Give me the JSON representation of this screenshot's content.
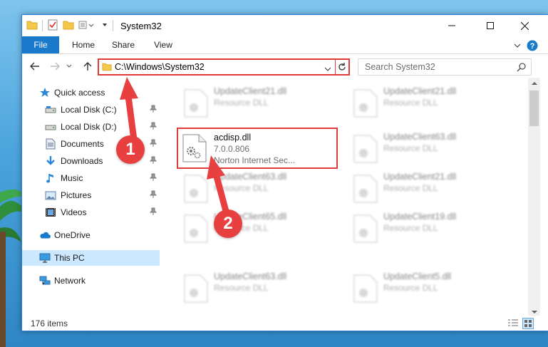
{
  "window": {
    "title": "System32",
    "buttons": {
      "minimize_icon": "minimize-icon",
      "maximize_icon": "maximize-icon",
      "close_icon": "close-icon"
    }
  },
  "ribbon": {
    "tabs": [
      {
        "label": "File",
        "active": true
      },
      {
        "label": "Home"
      },
      {
        "label": "Share"
      },
      {
        "label": "View"
      }
    ]
  },
  "navigation": {
    "address": "C:\\Windows\\System32",
    "search_placeholder": "Search System32"
  },
  "sidebar": {
    "items": [
      {
        "label": "Quick access",
        "icon": "star-icon"
      },
      {
        "label": "Local Disk (C:)",
        "icon": "drive-icon",
        "pinned": true
      },
      {
        "label": "Local Disk (D:)",
        "icon": "drive-icon",
        "pinned": true
      },
      {
        "label": "Documents",
        "icon": "documents-icon",
        "pinned": true
      },
      {
        "label": "Downloads",
        "icon": "downloads-icon",
        "pinned": true
      },
      {
        "label": "Music",
        "icon": "music-icon",
        "pinned": true
      },
      {
        "label": "Pictures",
        "icon": "pictures-icon",
        "pinned": true
      },
      {
        "label": "Videos",
        "icon": "videos-icon",
        "pinned": true
      },
      {
        "label": "OneDrive",
        "icon": "cloud-icon"
      },
      {
        "label": "This PC",
        "icon": "computer-icon",
        "selected": true
      },
      {
        "label": "Network",
        "icon": "network-icon"
      }
    ]
  },
  "files": {
    "left_column": [
      {
        "name": "UpdateClient21.dll",
        "type": "Resource DLL"
      },
      {
        "name": "UpdateClient63.dll",
        "type": "Resource DLL"
      },
      {
        "name": "UpdateClient65.dll",
        "type": "Resource DLL"
      },
      {
        "name": "UpdateClient63.dll",
        "type": "Resource DLL"
      }
    ],
    "right_column": [
      {
        "name": "UpdateClient21.dll",
        "type": "Resource DLL"
      },
      {
        "name": "UpdateClient63.dll",
        "type": "Resource DLL"
      },
      {
        "name": "UpdateClient21.dll",
        "type": "Resource DLL"
      },
      {
        "name": "UpdateClient19.dll",
        "type": "Resource DLL"
      },
      {
        "name": "UpdateClient5.dll",
        "type": "Resource DLL"
      }
    ],
    "highlighted": {
      "name": "acdisp.dll",
      "version": "7.0.0.806",
      "description": "Norton Internet Sec..."
    }
  },
  "status": {
    "item_count": "176 items"
  },
  "annotations": {
    "step1": "1",
    "step2": "2",
    "color": "#e84040"
  }
}
